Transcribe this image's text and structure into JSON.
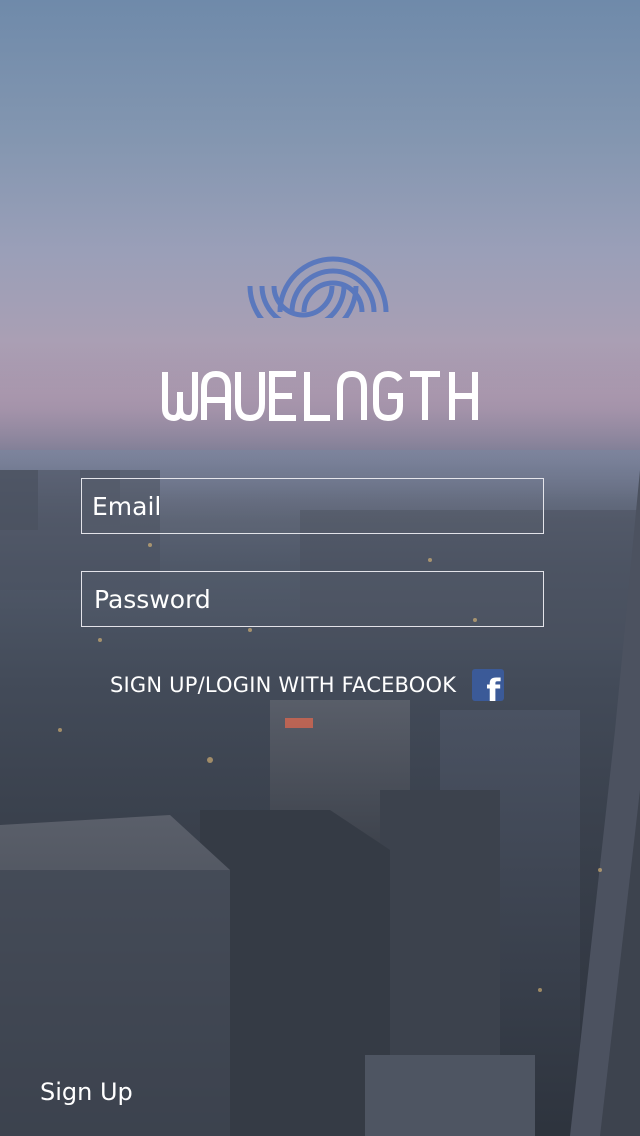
{
  "brand": {
    "name": "WAVELNGTH",
    "accent_color": "#5a78bd"
  },
  "login_form": {
    "email_placeholder": "Email",
    "password_placeholder": "Password"
  },
  "facebook": {
    "label": "SIGN UP/LOGIN WITH FACEBOOK",
    "icon": "facebook-icon",
    "icon_glyph": "f",
    "color": "#3b5a98"
  },
  "footer": {
    "signup_label": "Sign Up"
  }
}
